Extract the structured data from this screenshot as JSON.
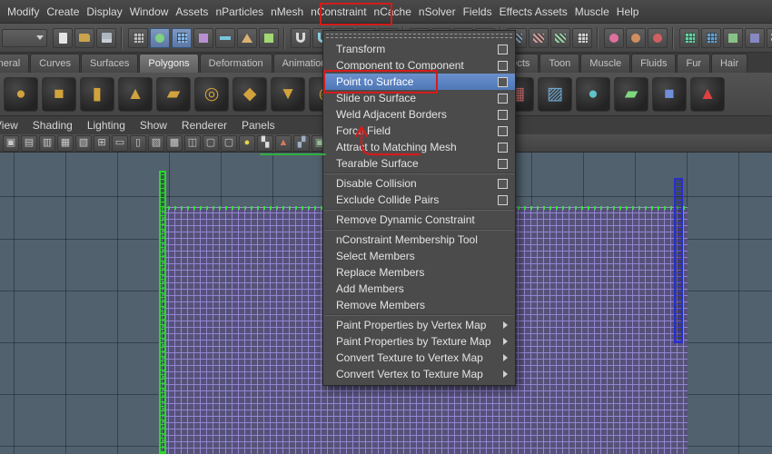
{
  "menubar": {
    "items": [
      "Modify",
      "Create",
      "Display",
      "Window",
      "Assets",
      "nParticles",
      "nMesh",
      "nConstraint",
      "nCache",
      "nSolver",
      "Fields",
      "Effects Assets",
      "Muscle",
      "Help"
    ],
    "annotated_item": "nConstraint"
  },
  "statusline": {
    "menu_set_dropdown": {
      "value": ""
    },
    "icons": [
      {
        "n": "new-scene-icon",
        "s": "page",
        "c": "#e6e6e6"
      },
      {
        "n": "open-scene-icon",
        "s": "folder",
        "c": "#c9a44c"
      },
      {
        "n": "save-scene-icon",
        "s": "disk",
        "c": "#aeb6bf"
      },
      {
        "sep": true
      },
      {
        "n": "select-hierarchy-icon",
        "s": "grid",
        "c": "#bcbcbc"
      },
      {
        "n": "select-object-mode-icon",
        "s": "circle",
        "c": "#7fd27f",
        "hl": true
      },
      {
        "n": "select-component-mode-icon",
        "s": "grid",
        "c": "#86b7ec",
        "hl": true
      },
      {
        "n": "select-points-icon",
        "s": "square",
        "c": "#b98fd4"
      },
      {
        "n": "select-lines-icon",
        "s": "bar",
        "c": "#79c7dd"
      },
      {
        "n": "select-faces-icon",
        "s": "triangle",
        "c": "#d9b273"
      },
      {
        "n": "select-hulls-icon",
        "s": "square",
        "c": "#a2d973"
      },
      {
        "sep": true
      },
      {
        "n": "snap-to-grid-icon",
        "s": "magnet",
        "c": "#d8d8d8"
      },
      {
        "n": "snap-to-curve-icon",
        "s": "magnet",
        "c": "#8fd4ea"
      },
      {
        "n": "snap-to-point-icon",
        "s": "magnet",
        "c": "#dde272"
      },
      {
        "n": "snap-to-view-plane-icon",
        "s": "magnet",
        "c": "#e2946f"
      },
      {
        "n": "snap-to-surface-icon",
        "s": "magnet",
        "c": "#c492e2"
      },
      {
        "sep": true
      },
      {
        "n": "make-live-icon",
        "s": "circle",
        "c": "#8fe2c2"
      },
      {
        "n": "input-connections-icon",
        "s": "bar",
        "c": "#cfcfcf"
      },
      {
        "n": "output-connections-icon",
        "s": "bar",
        "c": "#cfcfcf"
      },
      {
        "n": "construction-history-icon",
        "s": "grid",
        "c": "#e2d28f"
      },
      {
        "sep": true
      },
      {
        "n": "open-render-view-icon",
        "s": "clap",
        "c": "#9fb6cf"
      },
      {
        "n": "render-current-frame-icon",
        "s": "clap",
        "c": "#cf9f9f"
      },
      {
        "n": "ipr-render-icon",
        "s": "clap",
        "c": "#9fcfa9"
      },
      {
        "n": "render-settings-icon",
        "s": "grid",
        "c": "#cfcfcf"
      },
      {
        "sep": true
      },
      {
        "n": "paint-effects-icon",
        "s": "circle",
        "c": "#e06f9f"
      },
      {
        "n": "toon-shading-icon",
        "s": "circle",
        "c": "#d08f60"
      },
      {
        "n": "muscle-tool-icon",
        "s": "circle",
        "c": "#d06060"
      },
      {
        "sep": true
      },
      {
        "n": "poly-count-icon",
        "s": "grid",
        "c": "#60d0a0"
      },
      {
        "n": "hud-toggle-icon",
        "s": "grid",
        "c": "#60a0d0"
      },
      {
        "n": "layout-single-pane-icon",
        "s": "square",
        "c": "#87c287"
      },
      {
        "n": "layout-four-pane-icon",
        "s": "square",
        "c": "#8787c2"
      },
      {
        "n": "film-gate-icon",
        "s": "clap",
        "c": "#b0b0c4"
      },
      {
        "n": "resolution-gate-icon",
        "s": "clap",
        "c": "#b0c4b0"
      }
    ]
  },
  "shelf_tabs": {
    "left": [
      "General",
      "Curves",
      "Surfaces",
      "Polygons",
      "Deformation",
      "Animation"
    ],
    "right": [
      "Effects",
      "Toon",
      "Muscle",
      "Fluids",
      "Fur",
      "Hair"
    ],
    "active": "Polygons"
  },
  "shelf": {
    "icons": [
      {
        "n": "poly-sphere-icon",
        "g": "●",
        "c": "#d2a23c"
      },
      {
        "n": "poly-cube-icon",
        "g": "■",
        "c": "#d2a23c"
      },
      {
        "n": "poly-cylinder-icon",
        "g": "▮",
        "c": "#d2a23c"
      },
      {
        "n": "poly-cone-icon",
        "g": "▲",
        "c": "#d2a23c"
      },
      {
        "n": "poly-plane-icon",
        "g": "▰",
        "c": "#d2a23c"
      },
      {
        "n": "poly-torus-icon",
        "g": "◎",
        "c": "#d2a23c"
      },
      {
        "n": "poly-prism-icon",
        "g": "◆",
        "c": "#d2a23c"
      },
      {
        "n": "poly-pyramid-icon",
        "g": "▼",
        "c": "#d2a23c"
      },
      {
        "n": "poly-pipe-icon",
        "g": "◉",
        "c": "#d2a23c"
      },
      {
        "n": "poly-helix-icon",
        "g": "◈",
        "c": "#d2a23c"
      },
      {
        "n": "poly-soccer-ball-icon",
        "g": "◉",
        "c": "#c2923c"
      },
      {
        "n": "sculpt-geometry-icon",
        "g": "▦",
        "c": "#7fc2b0"
      },
      {
        "n": "mirror-geometry-icon",
        "g": "◧",
        "c": "#c2c2c2"
      },
      {
        "n": "quad-draw-icon",
        "g": "▦",
        "c": "#d07070"
      },
      {
        "n": "smooth-mesh-icon",
        "g": "▨",
        "c": "#70a8d0"
      },
      {
        "n": "nparticle-sphere-icon",
        "g": "●",
        "c": "#5fc2c8"
      },
      {
        "n": "ncloth-create-icon",
        "g": "▰",
        "c": "#7fd87f"
      },
      {
        "n": "nconstraint-shelf-icon",
        "g": "■",
        "c": "#6f8fd8"
      },
      {
        "n": "fluid-emitter-icon",
        "g": "▲",
        "c": "#e04040"
      }
    ]
  },
  "panel_menubar": {
    "items": [
      "View",
      "Shading",
      "Lighting",
      "Show",
      "Renderer",
      "Panels"
    ]
  },
  "panel_toolbar": {
    "icons": [
      {
        "n": "select-camera-icon",
        "g": "▣",
        "c": "#c9c9c9"
      },
      {
        "n": "lock-camera-icon",
        "g": "▤",
        "c": "#c9c9c9"
      },
      {
        "n": "camera-attributes-icon",
        "g": "▥",
        "c": "#c9c9c9"
      },
      {
        "n": "bookmarks-icon",
        "g": "▦",
        "c": "#c9c9c9"
      },
      {
        "n": "image-plane-icon",
        "g": "▧",
        "c": "#c9c9c9"
      },
      {
        "n": "view-grid-toggle-icon",
        "g": "⊞",
        "c": "#c9c9c9"
      },
      {
        "n": "film-gate-toggle-icon",
        "g": "▭",
        "c": "#c9c9c9"
      },
      {
        "n": "resolution-gate-toggle-icon",
        "g": "▯",
        "c": "#c9c9c9"
      },
      {
        "n": "gate-mask-icon",
        "g": "▨",
        "c": "#c9c9c9"
      },
      {
        "n": "field-chart-icon",
        "g": "▩",
        "c": "#c9c9c9"
      },
      {
        "n": "safe-action-icon",
        "g": "◫",
        "c": "#c9c9c9"
      },
      {
        "n": "safe-title-icon",
        "g": "▢",
        "c": "#c9c9c9"
      },
      {
        "n": "wireframe-mode-icon",
        "g": "▢",
        "c": "#c9c9c9"
      },
      {
        "n": "shaded-mode-icon",
        "g": "●",
        "c": "#e8d44a"
      },
      {
        "n": "textured-mode-icon",
        "g": "▚",
        "c": "#dcdcdc"
      },
      {
        "n": "lighting-mode-icon",
        "g": "▲",
        "c": "#d87a5a"
      },
      {
        "n": "xray-mode-icon",
        "g": "▞",
        "c": "#9ab0c4"
      },
      {
        "n": "isolate-select-icon",
        "g": "▣",
        "c": "#9ac49a"
      }
    ]
  },
  "nconstraint_menu": {
    "items": [
      {
        "label": "Transform",
        "option_box": true
      },
      {
        "label": "Component to Component",
        "option_box": true
      },
      {
        "label": "Point to Surface",
        "option_box": true,
        "highlighted": true
      },
      {
        "label": "Slide on Surface",
        "option_box": true
      },
      {
        "label": "Weld Adjacent Borders",
        "option_box": true
      },
      {
        "label": "Force Field",
        "option_box": true
      },
      {
        "label": "Attract to Matching Mesh",
        "option_box": true
      },
      {
        "label": "Tearable Surface",
        "option_box": true
      },
      {
        "separator": true
      },
      {
        "label": "Disable Collision",
        "option_box": true
      },
      {
        "label": "Exclude Collide Pairs",
        "option_box": true
      },
      {
        "separator": true
      },
      {
        "label": "Remove Dynamic Constraint"
      },
      {
        "separator": true
      },
      {
        "label": "nConstraint Membership Tool"
      },
      {
        "label": "Select Members"
      },
      {
        "label": "Replace Members"
      },
      {
        "label": "Add Members"
      },
      {
        "label": "Remove Members"
      },
      {
        "separator": true
      },
      {
        "label": "Paint Properties by Vertex Map",
        "submenu": true
      },
      {
        "label": "Paint Properties by Texture Map",
        "submenu": true
      },
      {
        "label": "Convert Texture to Vertex Map",
        "submenu": true
      },
      {
        "label": "Convert Vertex to Texture Map",
        "submenu": true
      }
    ],
    "highlight_color": "#5b84c4"
  },
  "viewport": {
    "background": "#51616d",
    "cloth_wire_color": "#988ad8",
    "selection_green": "#28d828",
    "constraint_blue": "#2a2ec8"
  },
  "annotations": {
    "color": "#d31c1c",
    "secondary_color": "#2fae3f",
    "boxed_items": [
      "nConstraint",
      "Point to Surface"
    ]
  }
}
